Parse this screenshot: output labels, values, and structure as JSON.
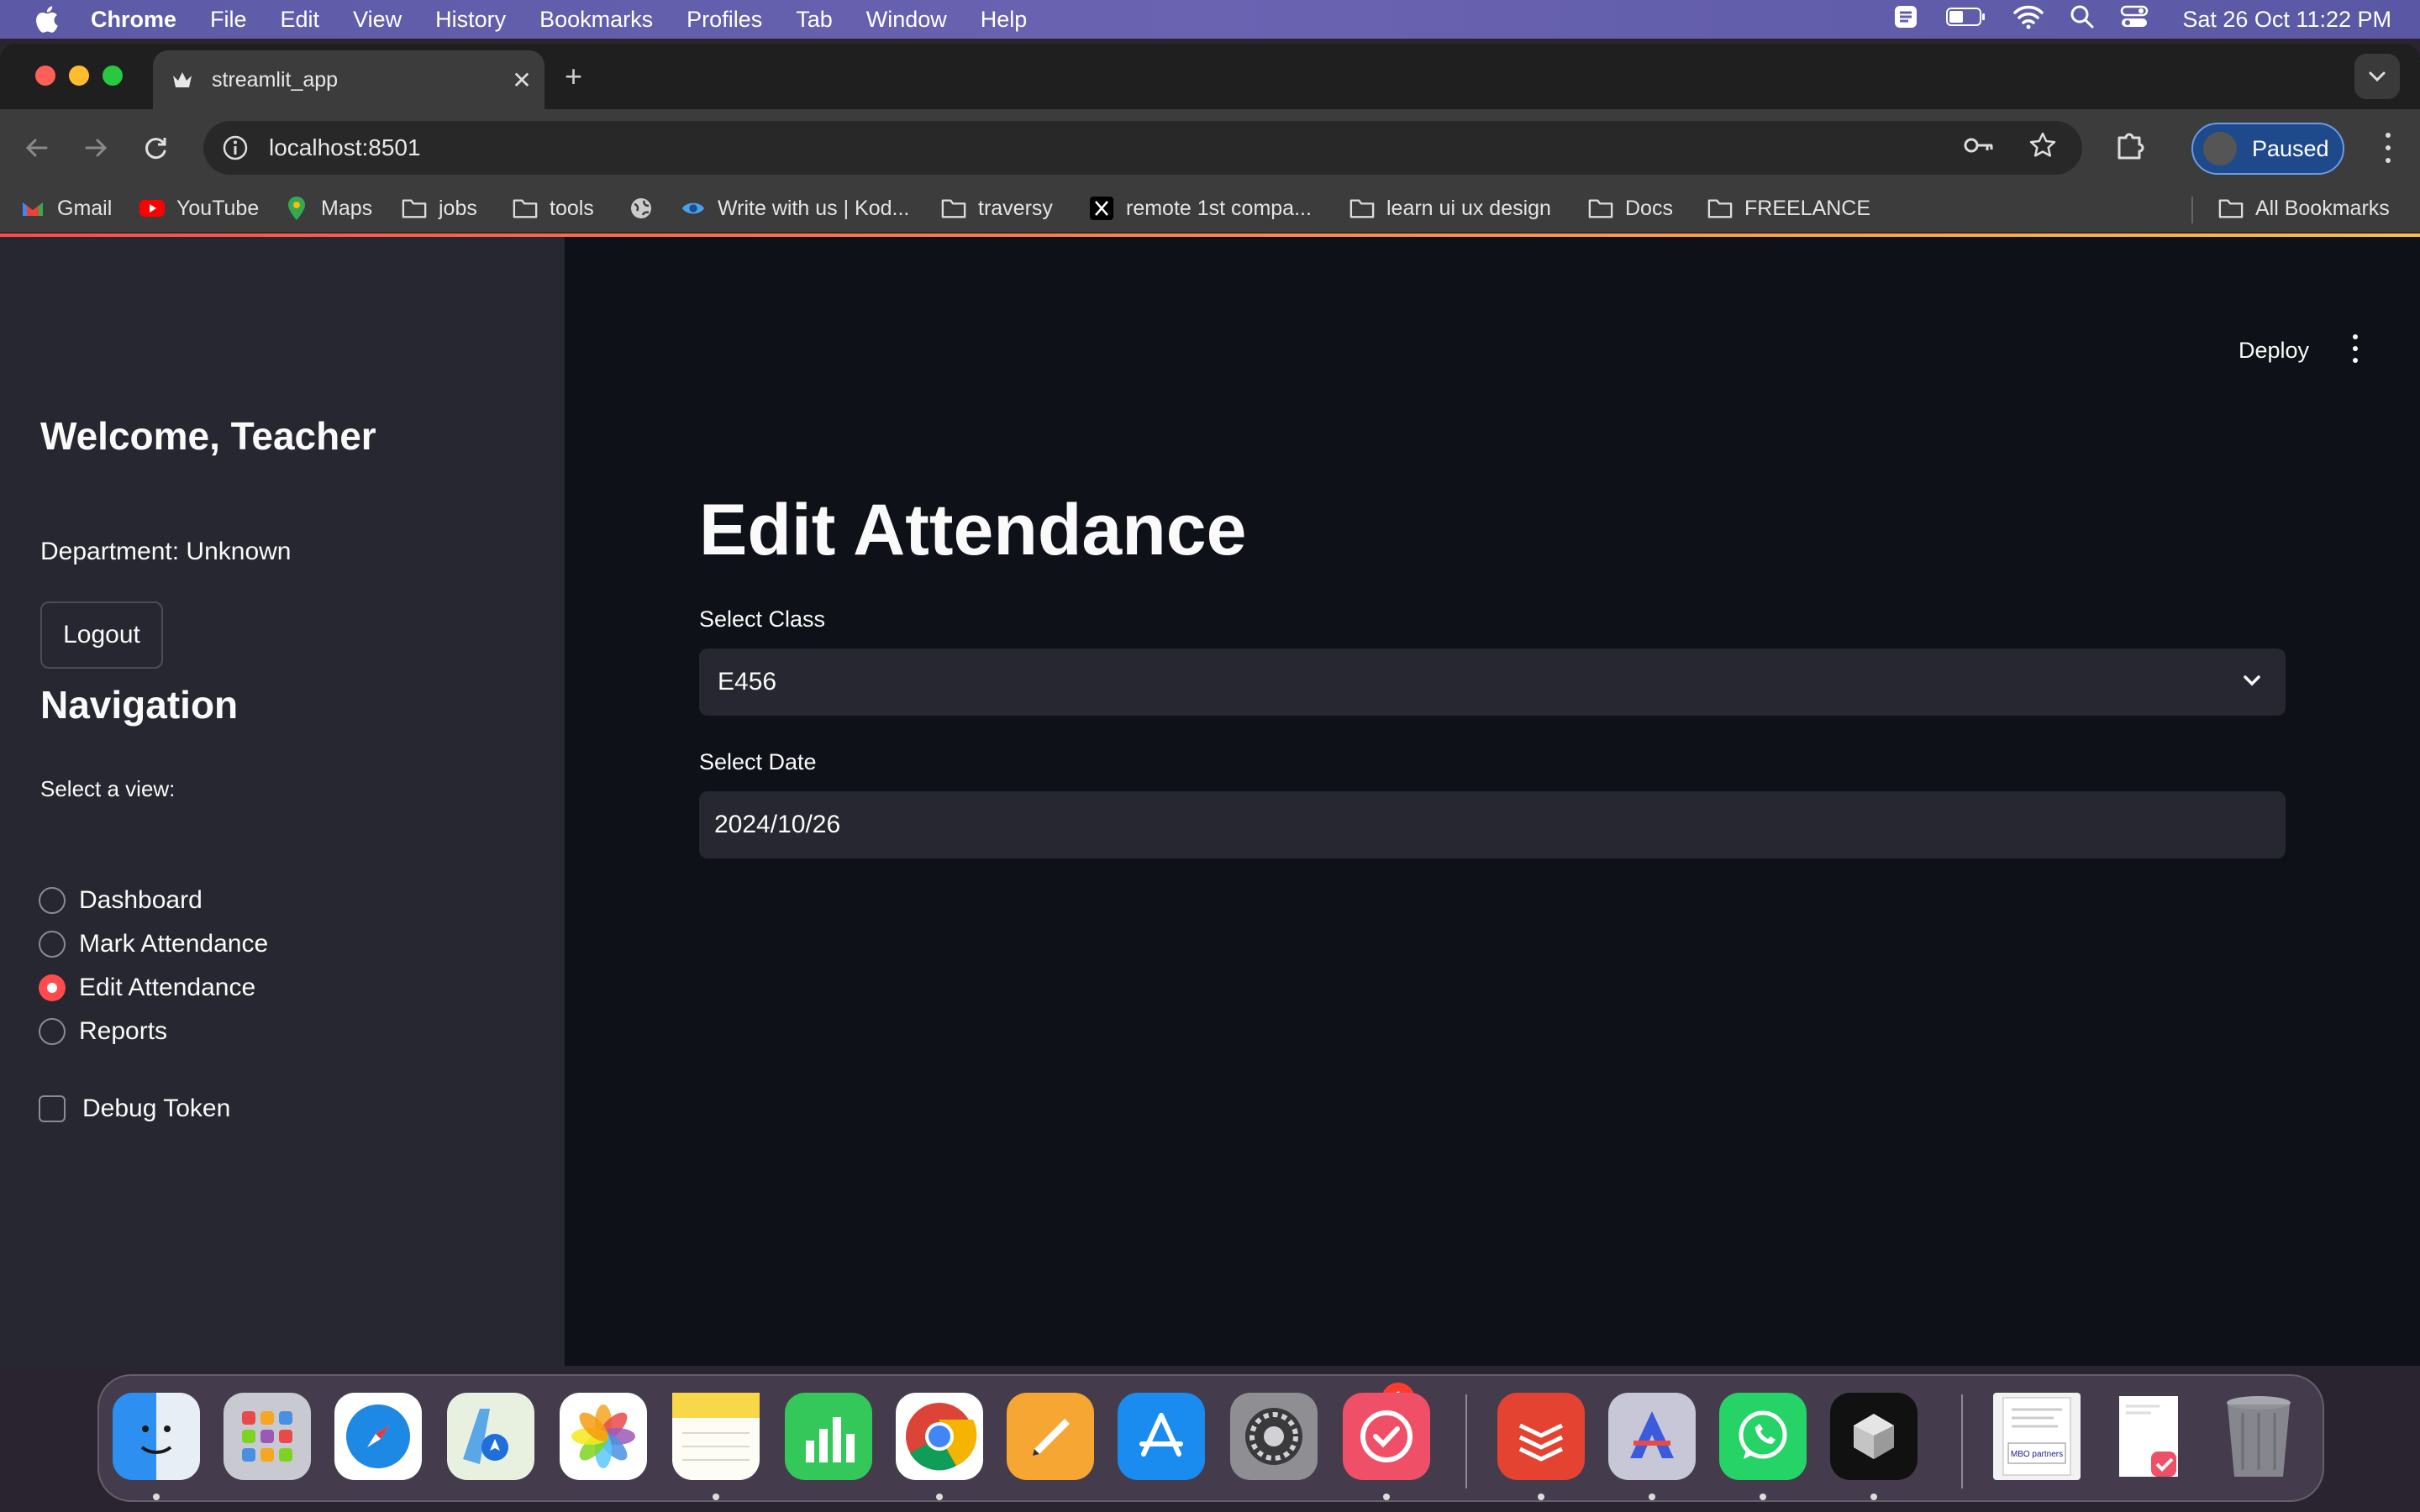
{
  "menubar": {
    "app_name": "Chrome",
    "items": [
      "File",
      "Edit",
      "View",
      "History",
      "Bookmarks",
      "Profiles",
      "Tab",
      "Window",
      "Help"
    ],
    "clock": "Sat 26 Oct  11:22 PM",
    "status_icons": [
      "app-icon",
      "battery-icon",
      "wifi-icon",
      "spotlight-search-icon",
      "control-center-icon"
    ]
  },
  "browser": {
    "tab_title": "streamlit_app",
    "url": "localhost:8501",
    "profile_label": "Paused",
    "bookmarks": [
      "Gmail",
      "YouTube",
      "Maps",
      "jobs",
      "tools",
      "Write with us | Kod...",
      "traversy",
      "remote 1st compa...",
      "learn ui ux design",
      "Docs",
      "FREELANCE"
    ],
    "all_bookmarks": "All Bookmarks"
  },
  "sidebar": {
    "welcome": "Welcome, Teacher",
    "department": "Department: Unknown",
    "logout_label": "Logout",
    "nav_title": "Navigation",
    "view_label": "Select a view:",
    "views": [
      "Dashboard",
      "Mark Attendance",
      "Edit Attendance",
      "Reports"
    ],
    "selected_view": "Edit Attendance",
    "debug_label": "Debug Token",
    "debug_checked": false
  },
  "main": {
    "deploy_label": "Deploy",
    "title": "Edit Attendance",
    "class_label": "Select Class",
    "class_value": "E456",
    "date_label": "Select Date",
    "date_value": "2024/10/26"
  },
  "dock": {
    "apps": [
      "finder",
      "launchpad",
      "safari",
      "maps",
      "photos",
      "notes",
      "numbers",
      "chrome",
      "pages",
      "app-store",
      "system-settings",
      "tasks",
      "todoist",
      "affinity",
      "whatsapp",
      "cube-app",
      "document-preview",
      "pdf-preview",
      "trash"
    ],
    "settings_badge": "1",
    "mbo_label": "MBO partners"
  },
  "colors": {
    "accent": "#ff4b4b",
    "sidebar_bg": "#262730",
    "main_bg": "#0e1117",
    "menubar": "#6260ac"
  }
}
